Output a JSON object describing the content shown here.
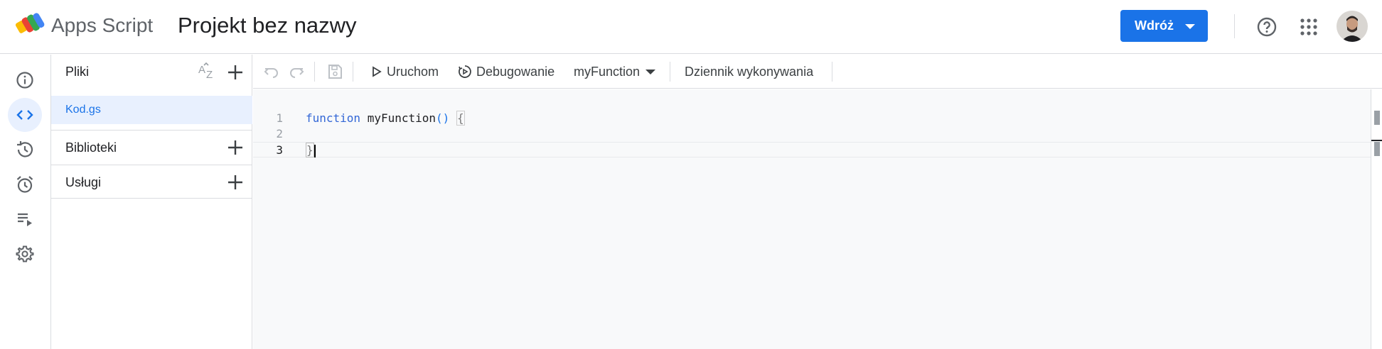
{
  "header": {
    "app_name": "Apps Script",
    "project_title": "Projekt bez nazwy",
    "deploy_label": "Wdróż"
  },
  "files_panel": {
    "title": "Pliki",
    "files": [
      {
        "name": "Kod.gs"
      }
    ],
    "sections": [
      {
        "label": "Biblioteki"
      },
      {
        "label": "Usługi"
      }
    ]
  },
  "toolbar": {
    "run_label": "Uruchom",
    "debug_label": "Debugowanie",
    "function_selected": "myFunction",
    "log_label": "Dziennik wykonywania"
  },
  "editor": {
    "lines": [
      {
        "number": "1",
        "text": "function myFunction() {"
      },
      {
        "number": "2",
        "text": ""
      },
      {
        "number": "3",
        "text": "}"
      }
    ],
    "current_line": 3
  },
  "colors": {
    "accent": "#1a73e8",
    "active_bg": "#e8f0fe",
    "editor_bg": "#f8f9fa",
    "border": "#dadce0"
  }
}
